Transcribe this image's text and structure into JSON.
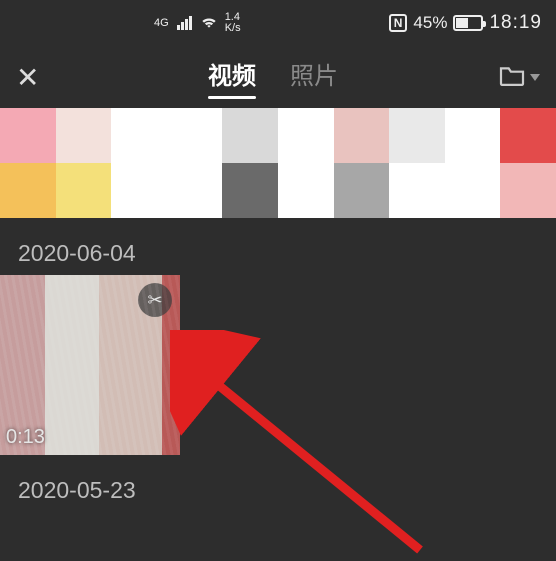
{
  "statusbar": {
    "net_label": "4G",
    "speed_value": "1.4",
    "speed_unit": "K/s",
    "nfc_label": "N",
    "battery_pct": "45%",
    "time": "18:19"
  },
  "nav": {
    "close_glyph": "✕",
    "tab_video": "视频",
    "tab_photo": "照片"
  },
  "sections": {
    "date1": "2020-06-04",
    "date2": "2020-05-23",
    "thumb1_duration": "0:13",
    "scissor_glyph": "✂"
  }
}
